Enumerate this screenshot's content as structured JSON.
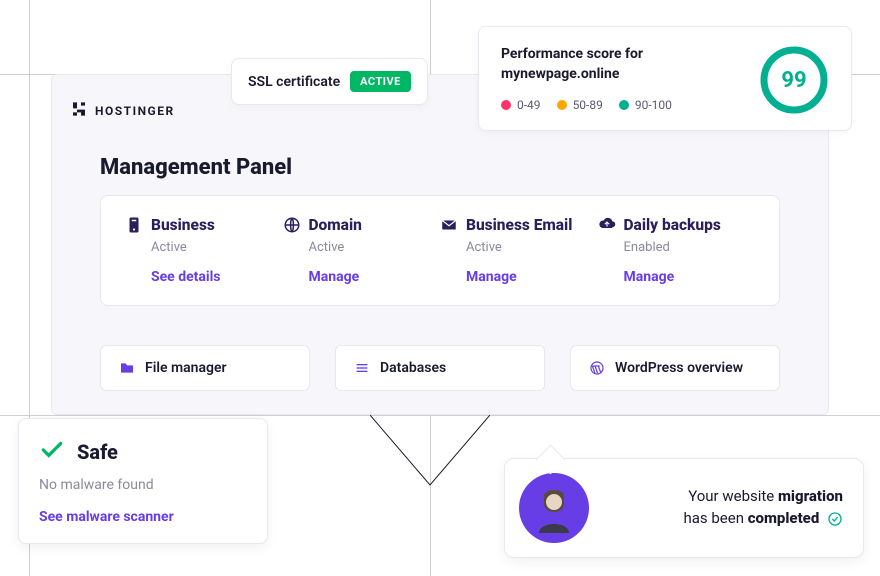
{
  "brand": {
    "name": "HOSTINGER"
  },
  "ssl": {
    "label": "SSL certificate",
    "badge": "ACTIVE"
  },
  "performance": {
    "title_prefix": "Performance score for",
    "domain": "mynewpage.online",
    "score": "99",
    "legend": {
      "low": "0-49",
      "mid": "50-89",
      "high": "90-100"
    }
  },
  "panel": {
    "title": "Management Panel"
  },
  "services": {
    "business": {
      "name": "Business",
      "status": "Active",
      "action": "See details"
    },
    "domain": {
      "name": "Domain",
      "status": "Active",
      "action": "Manage"
    },
    "email": {
      "name": "Business Email",
      "status": "Active",
      "action": "Manage"
    },
    "backups": {
      "name": "Daily backups",
      "status": "Enabled",
      "action": "Manage"
    }
  },
  "tools": {
    "file_manager": "File manager",
    "databases": "Databases",
    "wordpress": "WordPress overview"
  },
  "safe": {
    "title": "Safe",
    "subtitle": "No malware found",
    "link": "See malware scanner"
  },
  "migration": {
    "line1_a": "Your website ",
    "line1_b": "migration",
    "line2_a": "has been ",
    "line2_b": "completed"
  }
}
